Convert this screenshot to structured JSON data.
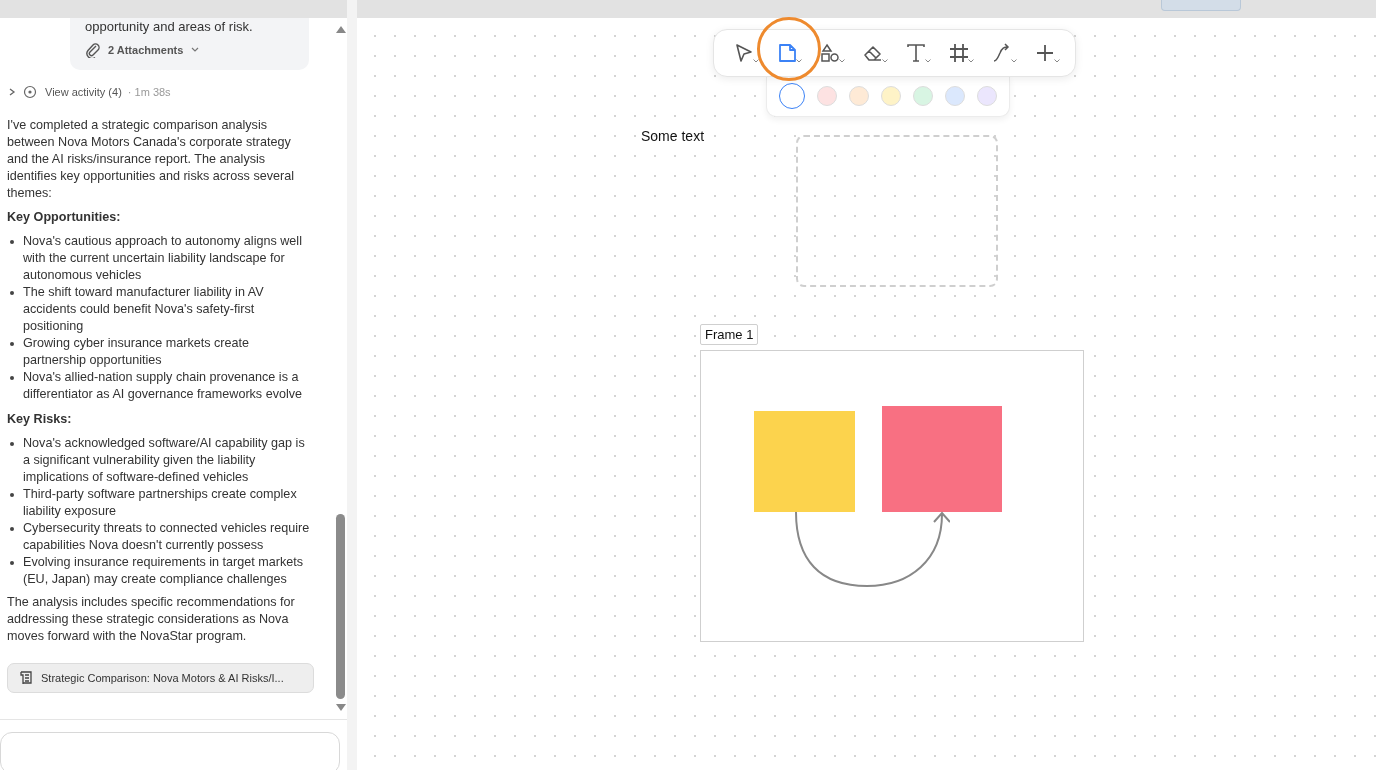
{
  "chat": {
    "message_tail": "opportunity and areas of risk.",
    "attachments": "2 Attachments",
    "activity": {
      "label": "View activity (4)",
      "time": "· 1m 38s",
      "expanded": false
    },
    "response": [
      {
        "kind": "paragraph",
        "text": "I've completed a strategic comparison analysis between Nova Motors Canada's corporate strategy and the AI risks/insurance report. The analysis identifies key opportunities and risks across several themes:"
      },
      {
        "kind": "heading",
        "text": "Key Opportunities:"
      },
      {
        "kind": "list",
        "items": [
          "Nova's cautious approach to autonomy aligns well with the current uncertain liability landscape for autonomous vehicles",
          "The shift toward manufacturer liability in AV accidents could benefit Nova's safety-first positioning",
          "Growing cyber insurance markets create partnership opportunities",
          "Nova's allied-nation supply chain provenance is a differentiator as AI governance frameworks evolve"
        ]
      },
      {
        "kind": "heading",
        "text": "Key Risks:"
      },
      {
        "kind": "list",
        "items": [
          "Nova's acknowledged software/AI capability gap is a significant vulnerability given the liability implications of software-defined vehicles",
          "Third-party software partnerships create complex liability exposure",
          "Cybersecurity threats to connected vehicles require capabilities Nova doesn't currently possess",
          "Evolving insurance requirements in target markets (EU, Japan) may create compliance challenges"
        ]
      },
      {
        "kind": "paragraph",
        "text": "The analysis includes specific recommendations for addressing these strategic considerations as Nova moves forward with the NovaStar program."
      }
    ],
    "artifact": "Strategic Comparison: Nova Motors & AI Risks/I..."
  },
  "toolbar": {
    "tools": [
      {
        "kind": "select",
        "selected": false
      },
      {
        "kind": "note",
        "selected": true
      },
      {
        "kind": "shapes",
        "selected": false
      },
      {
        "kind": "eraser",
        "selected": false
      },
      {
        "kind": "text",
        "selected": false
      },
      {
        "kind": "frame",
        "selected": false
      },
      {
        "kind": "connector",
        "selected": false
      },
      {
        "kind": "add",
        "selected": false
      }
    ],
    "colors": [
      {
        "color": "#ffffff",
        "selected": true
      },
      {
        "color": "#fde2e2",
        "selected": false
      },
      {
        "color": "#feead6",
        "selected": false
      },
      {
        "color": "#fef3c7",
        "selected": false
      },
      {
        "color": "#d8f5e3",
        "selected": false
      },
      {
        "color": "#dbe8fd",
        "selected": false
      },
      {
        "color": "#ebe6fd",
        "selected": false
      }
    ]
  },
  "canvas": {
    "text": "Some text",
    "frame_label": "Frame 1",
    "shapes": [
      {
        "kind": "placeholder"
      },
      {
        "kind": "square",
        "color": "#fcd34d"
      },
      {
        "kind": "square",
        "color": "#f87082"
      },
      {
        "kind": "arrow"
      }
    ]
  }
}
